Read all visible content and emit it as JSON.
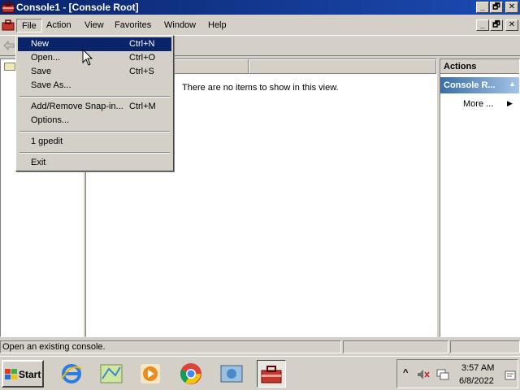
{
  "window": {
    "title": "Console1 - [Console Root]",
    "minimize_glyph": "_",
    "maximize_glyph": "🗗",
    "close_glyph": "✕",
    "app_icon": "mmc-toolbox-icon"
  },
  "menubar": {
    "items": [
      "File",
      "Action",
      "View",
      "Favorites",
      "Window",
      "Help"
    ],
    "active": "File"
  },
  "file_menu": {
    "groups": [
      [
        {
          "label": "New",
          "shortcut": "Ctrl+N"
        },
        {
          "label": "Open...",
          "shortcut": "Ctrl+O"
        },
        {
          "label": "Save",
          "shortcut": "Ctrl+S"
        },
        {
          "label": "Save As...",
          "shortcut": ""
        }
      ],
      [
        {
          "label": "Add/Remove Snap-in...",
          "shortcut": "Ctrl+M"
        },
        {
          "label": "Options...",
          "shortcut": ""
        }
      ],
      [
        {
          "label": "1 gpedit",
          "shortcut": ""
        }
      ],
      [
        {
          "label": "Exit",
          "shortcut": ""
        }
      ]
    ],
    "highlighted": "New"
  },
  "list_pane": {
    "empty_message": "There are no items to show in this view."
  },
  "actions_pane": {
    "header": "Actions",
    "section_title": "Console R...",
    "more_label": "More ...",
    "collapse_glyph": "▲",
    "more_arrow_glyph": "▶"
  },
  "statusbar": {
    "text": "Open an existing console."
  },
  "taskbar": {
    "start_label": "Start",
    "pinned_icons": [
      "internet-explorer-icon",
      "map-icon",
      "media-player-icon",
      "chrome-icon",
      "gpedit-icon",
      "mmc-console-icon"
    ],
    "active_icon": "mmc-console-icon",
    "tray_chevron": "^",
    "clock_time": "3:57 AM",
    "clock_date": "6/8/2022"
  },
  "colors": {
    "titlebar": "#0a246a",
    "menu_highlight": "#0a246a",
    "actions_section": "#3a6ea5",
    "face": "#d4d0c8"
  }
}
